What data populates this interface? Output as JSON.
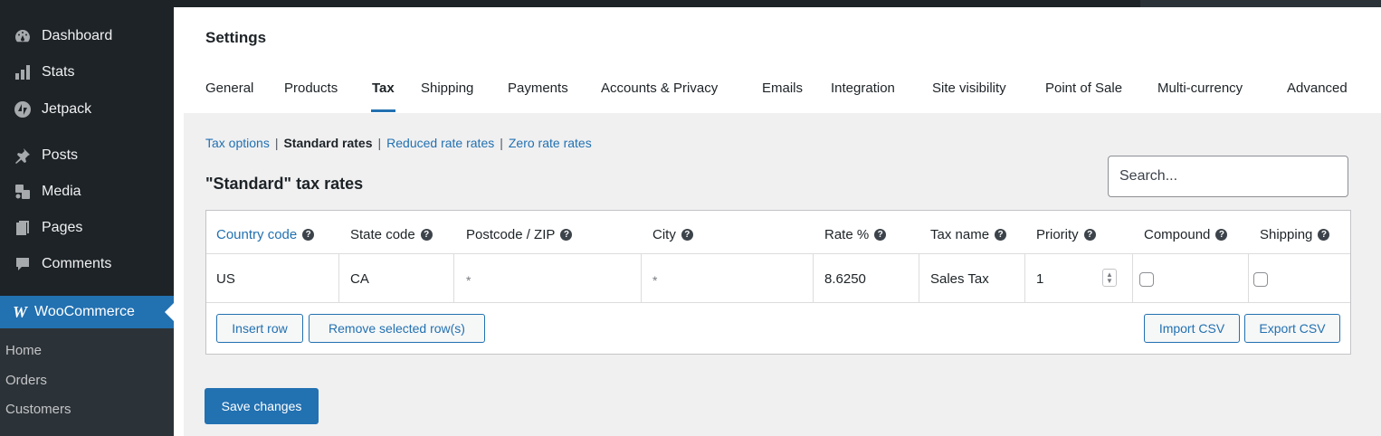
{
  "sidebar": {
    "items": [
      {
        "label": "Dashboard",
        "icon": "dashboard-icon"
      },
      {
        "label": "Stats",
        "icon": "stats-icon"
      },
      {
        "label": "Jetpack",
        "icon": "jetpack-icon"
      },
      {
        "label": "Posts",
        "icon": "pin-icon"
      },
      {
        "label": "Media",
        "icon": "media-icon"
      },
      {
        "label": "Pages",
        "icon": "pages-icon"
      },
      {
        "label": "Comments",
        "icon": "comments-icon"
      }
    ],
    "woocommerce": {
      "label": "WooCommerce",
      "icon_text": "W"
    },
    "submenu": [
      "Home",
      "Orders",
      "Customers"
    ]
  },
  "header": {
    "title": "Settings",
    "tabs": [
      "General",
      "Products",
      "Tax",
      "Shipping",
      "Payments",
      "Accounts & Privacy",
      "Emails",
      "Integration",
      "Site visibility",
      "Point of Sale",
      "Multi-currency",
      "Advanced"
    ],
    "active_tab": "Tax"
  },
  "subnav": {
    "links": [
      "Tax options",
      "Standard rates",
      "Reduced rate rates",
      "Zero rate rates"
    ],
    "separator": "|",
    "current": "Standard rates"
  },
  "section": {
    "title": "\"Standard\" tax rates",
    "search_placeholder": "Search..."
  },
  "table": {
    "columns": [
      "Country code",
      "State code",
      "Postcode / ZIP",
      "City",
      "Rate %",
      "Tax name",
      "Priority",
      "Compound",
      "Shipping"
    ],
    "help_glyph": "?",
    "rows": [
      {
        "country": "US",
        "state": "CA",
        "postcode": "*",
        "city": "*",
        "rate": "8.6250",
        "name": "Sales Tax",
        "priority": "1",
        "compound": false,
        "shipping": false
      }
    ]
  },
  "buttons": {
    "insert_row": "Insert row",
    "remove_rows": "Remove selected row(s)",
    "import_csv": "Import CSV",
    "export_csv": "Export CSV",
    "save": "Save changes"
  },
  "colors": {
    "sidebar_bg": "#1d2327",
    "accent": "#2271b1",
    "content_bg": "#f0f0f1"
  }
}
